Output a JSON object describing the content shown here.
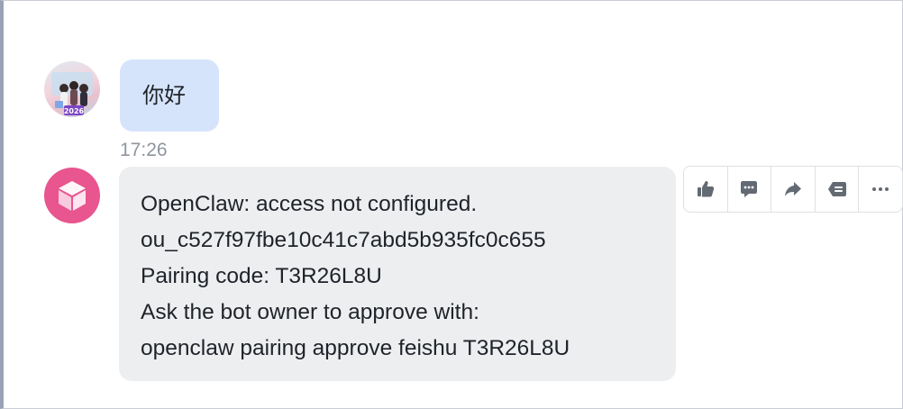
{
  "conversation": {
    "user_message": {
      "text": "你好",
      "avatar_icon": "user-avatar-photo",
      "avatar_caption": "2026"
    },
    "timestamp": "17:26",
    "bot_message": {
      "avatar_icon": "cube-icon",
      "lines": [
        "OpenClaw: access not configured.",
        "ou_c527f97fbe10c41c7abd5b935fc0c655",
        "Pairing code: T3R26L8U",
        "Ask the bot owner to approve with:",
        "openclaw pairing approve feishu T3R26L8U"
      ]
    }
  },
  "message_toolbar": {
    "actions": [
      "thumbs-up-icon",
      "comment-icon",
      "forward-icon",
      "quote-icon",
      "more-icon"
    ]
  },
  "colors": {
    "user_bubble": "#d6e4fb",
    "bot_bubble": "#edeef0",
    "bot_avatar": "#e8558f",
    "icon": "#646a73",
    "timestamp": "#8f959e"
  }
}
